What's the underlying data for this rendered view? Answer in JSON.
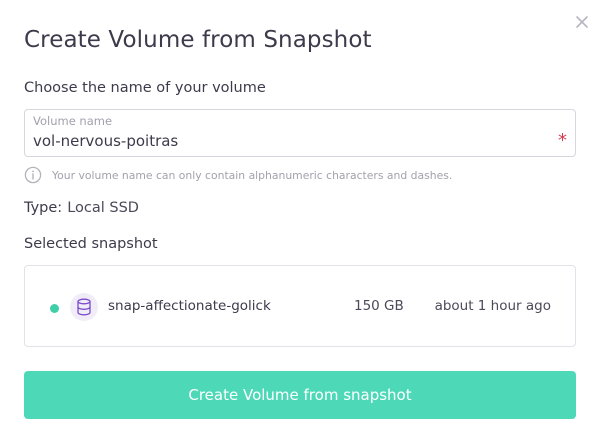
{
  "dialog": {
    "title": "Create Volume from Snapshot",
    "close_icon": "close-icon"
  },
  "name_section": {
    "heading": "Choose the name of your volume",
    "field_label": "Volume name",
    "value": "vol-nervous-poitras",
    "required_mark": "*",
    "helper_icon": "info-icon",
    "helper_text": "Your volume name can only contain alphanumeric characters and dashes."
  },
  "type": {
    "label": "Type:",
    "value": "Local SSD"
  },
  "snapshot_section": {
    "heading": "Selected snapshot",
    "snapshot": {
      "status_color": "#3ecfa8",
      "icon": "database-icon",
      "name": "snap-affectionate-golick",
      "size": "150 GB",
      "created": "about 1 hour ago"
    }
  },
  "actions": {
    "submit_label": "Create Volume from snapshot"
  },
  "colors": {
    "accent": "#4dd9b8",
    "required": "#d63a4d",
    "icon_purple": "#7c4dcc"
  }
}
